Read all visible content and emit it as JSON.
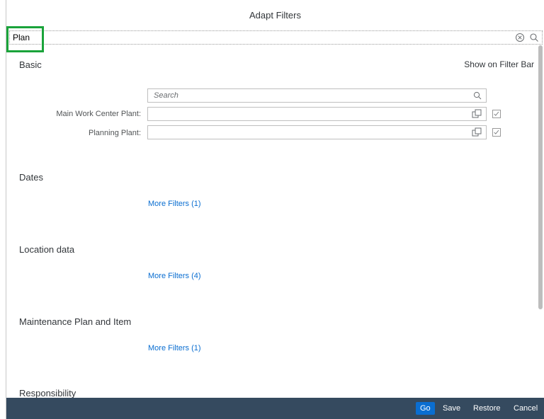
{
  "dialog": {
    "title": "Adapt Filters",
    "search": {
      "value": "Plan"
    }
  },
  "basic": {
    "title": "Basic",
    "show_on_filter_bar": "Show on Filter Bar",
    "filter_search_placeholder": "Search",
    "fields": [
      {
        "label": "Main Work Center Plant:",
        "value": "",
        "show_on_bar": true
      },
      {
        "label": "Planning Plant:",
        "value": "",
        "show_on_bar": true
      }
    ]
  },
  "groups": [
    {
      "title": "Dates",
      "more_filters": "More Filters (1)"
    },
    {
      "title": "Location data",
      "more_filters": "More Filters (4)"
    },
    {
      "title": "Maintenance Plan and Item",
      "more_filters": "More Filters (1)"
    },
    {
      "title": "Responsibility"
    }
  ],
  "footer": {
    "go": "Go",
    "save": "Save",
    "restore": "Restore",
    "cancel": "Cancel"
  },
  "colors": {
    "accent": "#0a6ed1",
    "footer_bg": "#354a5f",
    "highlight": "#1aa33a"
  },
  "icons": [
    "clear-icon",
    "search-icon",
    "value-help-icon",
    "checkbox-checked-icon"
  ]
}
